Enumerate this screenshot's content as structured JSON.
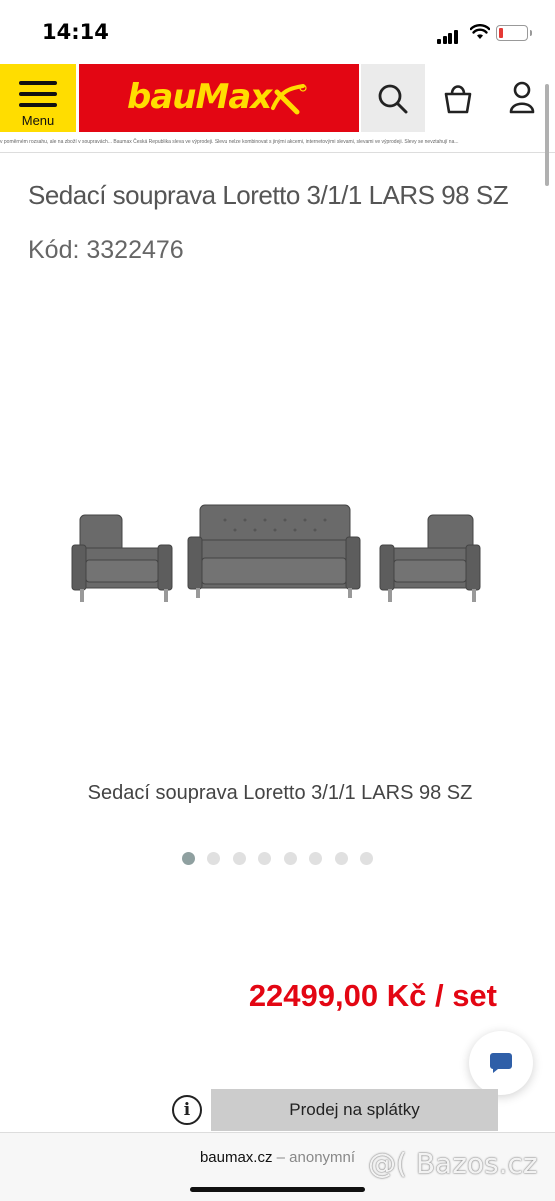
{
  "status_bar": {
    "time": "14:14"
  },
  "header": {
    "menu_label": "Menu",
    "logo_text": "bauMax",
    "brand_colors": {
      "red": "#e30613",
      "yellow": "#ffdd00"
    },
    "ticker_text": "v poměrném rozsahu, ale na zboží v soupravách... Baumax Česká Republika sleva ve výprodeji. Slevu nelze kombinovat s jinými akcemi, internetovými slevami, slevami ve výprodeji. Slevy se nevztahují na..."
  },
  "product": {
    "title": "Sedací souprava Loretto 3/1/1 LARS 98 SZ",
    "code": "Kód: 3322476",
    "image_caption": "Sedací souprava Loretto 3/1/1 LARS 98 SZ",
    "carousel": {
      "count": 8,
      "active_index": 0
    },
    "price": "22499,00 Kč / set",
    "price_color": "#e30613"
  },
  "actions": {
    "installment_label": "Prodej na splátky",
    "info_glyph": "i",
    "chat_icon": "chat-bubble-icon"
  },
  "browser": {
    "domain": "baumax.cz",
    "mode": "– anonymní"
  },
  "watermark": "@( Bazos.cz"
}
